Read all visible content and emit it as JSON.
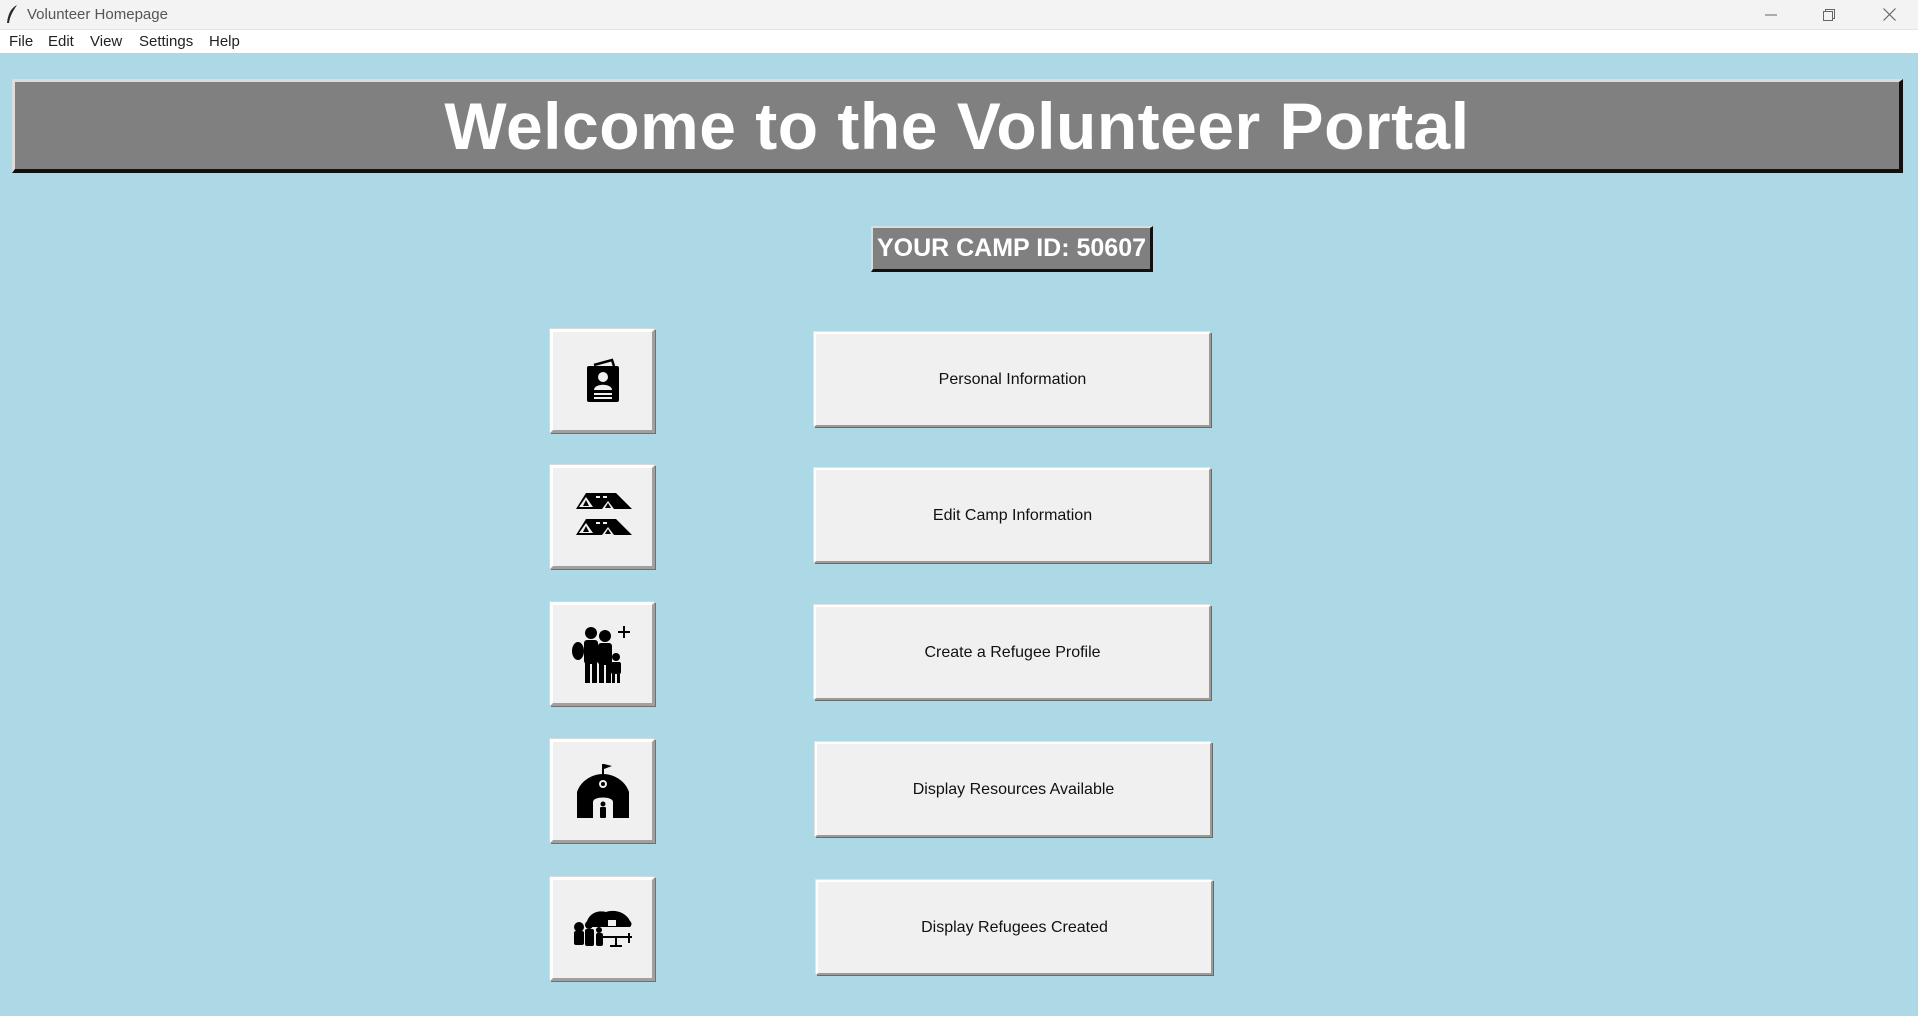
{
  "window": {
    "title": "Volunteer Homepage",
    "controls": [
      "minimize-icon",
      "restore-icon",
      "close-icon"
    ]
  },
  "menu": {
    "items": [
      "File",
      "Edit",
      "View",
      "Settings",
      "Help"
    ]
  },
  "header": {
    "title": "Welcome to the Volunteer Portal"
  },
  "camp": {
    "label": "YOUR CAMP ID: 50607"
  },
  "actions": [
    {
      "label": "Personal Information",
      "icon": "id-card-icon"
    },
    {
      "label": "Edit Camp Information",
      "icon": "camp-tents-icon"
    },
    {
      "label": "Create a Refugee Profile",
      "icon": "add-family-icon"
    },
    {
      "label": "Display Resources Available",
      "icon": "shelter-building-icon"
    },
    {
      "label": "Display Refugees Created",
      "icon": "refugee-group-icon"
    }
  ],
  "colors": {
    "background": "#add8e6",
    "header_bg": "#808080",
    "button_bg": "#f0f0f0"
  }
}
